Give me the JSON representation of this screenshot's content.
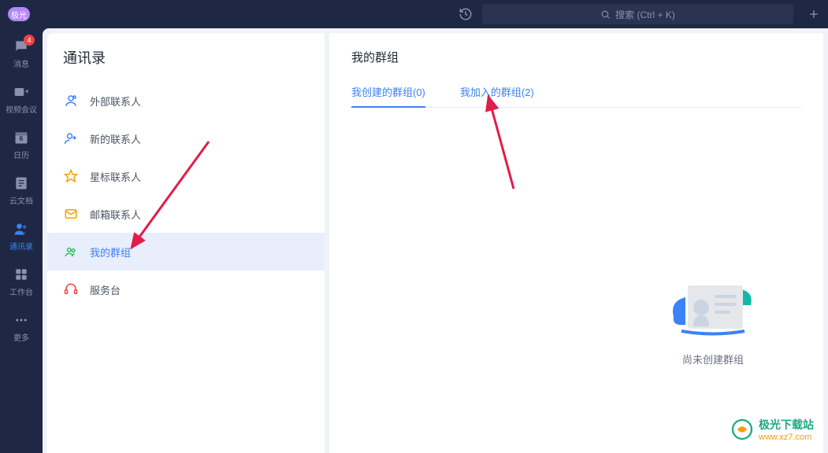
{
  "topbar": {
    "avatar_label": "极光",
    "search_placeholder": "搜索 (Ctrl + K)"
  },
  "leftnav": {
    "messages": {
      "label": "消息",
      "badge": "4"
    },
    "video": {
      "label": "视频会议"
    },
    "calendar": {
      "label": "日历",
      "day": "6"
    },
    "docs": {
      "label": "云文档"
    },
    "contacts": {
      "label": "通讯录"
    },
    "workspace": {
      "label": "工作台"
    },
    "more": {
      "label": "更多"
    }
  },
  "contacts_panel": {
    "title": "通讯录",
    "rows": {
      "external": "外部联系人",
      "new": "新的联系人",
      "starred": "星标联系人",
      "mailbox": "邮箱联系人",
      "mygroups": "我的群组",
      "helpdesk": "服务台"
    }
  },
  "detail": {
    "title": "我的群组",
    "tab_created": "我创建的群组(0)",
    "tab_joined": "我加入的群组(2)",
    "empty": "尚未创建群组"
  },
  "watermark": {
    "title": "极光下载站",
    "url": "www.xz7.com"
  }
}
